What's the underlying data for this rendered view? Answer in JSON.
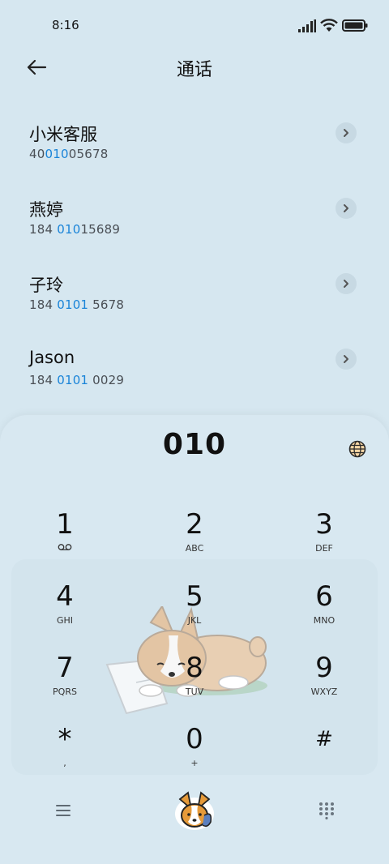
{
  "status": {
    "time": "8:16"
  },
  "header": {
    "title": "通话"
  },
  "contacts": [
    {
      "name": "小米客服",
      "num_pre": "40",
      "num_hl": "010",
      "num_post": "05678"
    },
    {
      "name": "燕婷",
      "num_pre": "184 ",
      "num_hl": "010",
      "num_post": "15689"
    },
    {
      "name": "子玲",
      "num_pre": "184 ",
      "num_hl": "0101",
      "num_post": " 5678"
    },
    {
      "name": "Jason",
      "num_pre": "184 ",
      "num_hl": "0101",
      "num_post": " 0029"
    }
  ],
  "dialer": {
    "display": "010",
    "keys": [
      {
        "digit": "1",
        "letters": ""
      },
      {
        "digit": "2",
        "letters": "ABC"
      },
      {
        "digit": "3",
        "letters": "DEF"
      },
      {
        "digit": "4",
        "letters": "GHI"
      },
      {
        "digit": "5",
        "letters": "JKL"
      },
      {
        "digit": "6",
        "letters": "MNO"
      },
      {
        "digit": "7",
        "letters": "PQRS"
      },
      {
        "digit": "8",
        "letters": "TUV"
      },
      {
        "digit": "9",
        "letters": "WXYZ"
      },
      {
        "digit": "*",
        "letters": ","
      },
      {
        "digit": "0",
        "letters": "+"
      },
      {
        "digit": "#",
        "letters": ""
      }
    ]
  },
  "icons": {
    "key1_sub": "voicemail-icon",
    "back": "arrow-left-icon",
    "chevron": "chevron-right-icon",
    "menu": "menu-icon",
    "grid": "dialpad-grid-icon",
    "call": "corgi-call-icon"
  },
  "colors": {
    "highlight": "#1a84d8",
    "background": "#d6e7f0"
  }
}
